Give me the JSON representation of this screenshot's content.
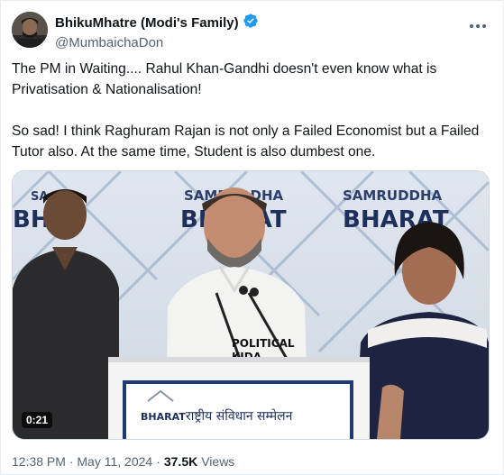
{
  "author": {
    "display_name": "BhikuMhatre (Modi's Family)",
    "handle": "@MumbaichaDon",
    "verified": true,
    "verified_color": "#1d9bf0"
  },
  "tweet": {
    "text": "The PM in Waiting.... Rahul Khan-Gandhi doesn't even know what is Privatisation & Nationalisation!\n\nSo sad! I think Raghuram Rajan is not only a Failed Economist but a Failed Tutor also. At the same time, Student is also dumbest one."
  },
  "media": {
    "duration": "0:21",
    "backdrop": {
      "brand_top": "SAMRUDDHA",
      "brand_bottom": "BHARAT",
      "brand_partial_left_top": "SA",
      "brand_partial_left_bottom": "BHA",
      "brand_mid_top": "SAMRUDDHA",
      "brand_mid_bottom": "BHARAT"
    },
    "shirt_text_line1": "POLITICAL",
    "shirt_text_line2": "KIDA.",
    "podium_brand": "BHARAT",
    "podium_text": "राष्ट्रीय संविधान सम्मेलन"
  },
  "meta": {
    "time": "12:38 PM",
    "separator": "·",
    "date": "May 11, 2024",
    "views_count": "37.5K",
    "views_label": "Views"
  },
  "icons": {
    "more": "more-horizontal-icon",
    "verified": "verified-badge-icon"
  }
}
